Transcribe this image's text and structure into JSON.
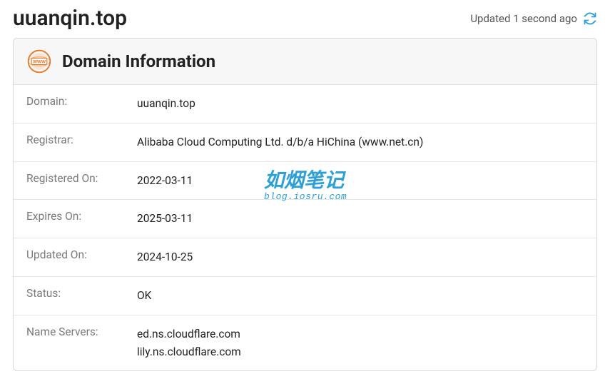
{
  "header": {
    "title": "uuanqin.top",
    "updated_text": "Updated 1 second ago"
  },
  "card": {
    "title": "Domain Information"
  },
  "info": {
    "domain_label": "Domain:",
    "domain_value": "uuanqin.top",
    "registrar_label": "Registrar:",
    "registrar_value": "Alibaba Cloud Computing Ltd. d/b/a HiChina (www.net.cn)",
    "registered_label": "Registered On:",
    "registered_value": "2022-03-11",
    "expires_label": "Expires On:",
    "expires_value": "2025-03-11",
    "updated_label": "Updated On:",
    "updated_value": "2024-10-25",
    "status_label": "Status:",
    "status_value": "OK",
    "ns_label": "Name Servers:",
    "ns1": "ed.ns.cloudflare.com",
    "ns2": "lily.ns.cloudflare.com"
  },
  "watermark": {
    "main": "如烟笔记",
    "sub": "blog.iosru.com"
  }
}
